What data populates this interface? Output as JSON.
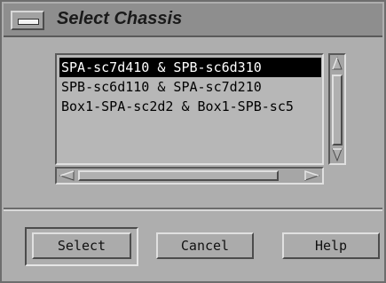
{
  "window": {
    "title": "Select Chassis"
  },
  "chassis_list": {
    "items": [
      {
        "label": "SPA-sc7d410 & SPB-sc6d310",
        "selected": true
      },
      {
        "label": "SPB-sc6d110 & SPA-sc7d210",
        "selected": false
      },
      {
        "label": "Box1-SPA-sc2d2 & Box1-SPB-sc5",
        "selected": false
      }
    ]
  },
  "buttons": {
    "select": "Select",
    "cancel": "Cancel",
    "help": "Help"
  },
  "icons": {
    "window_menu": "window-menu-icon",
    "scroll_up": "arrow-up-icon",
    "scroll_down": "arrow-down-icon",
    "scroll_left": "arrow-left-icon",
    "scroll_right": "arrow-right-icon"
  }
}
